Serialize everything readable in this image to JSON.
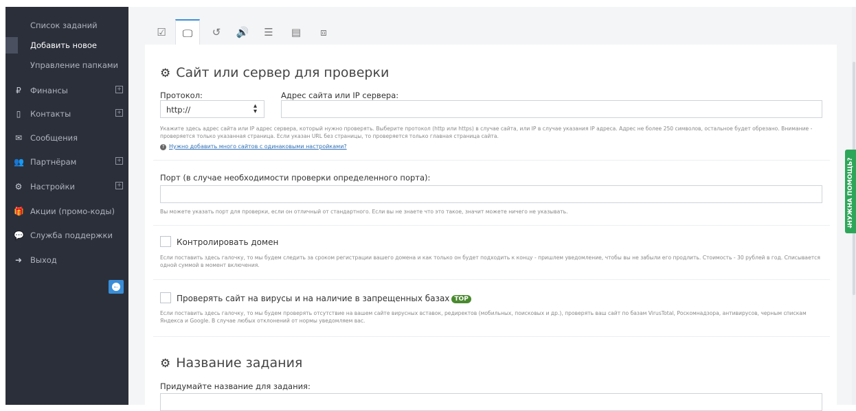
{
  "sidebar": {
    "sub_items": [
      {
        "label": "Список заданий"
      },
      {
        "label": "Добавить новое"
      },
      {
        "label": "Управление папками"
      }
    ],
    "nav": [
      {
        "icon": "₽",
        "label": "Финансы",
        "expandable": true
      },
      {
        "icon": "▯",
        "label": "Контакты",
        "expandable": true
      },
      {
        "icon": "✉",
        "label": "Сообщения",
        "expandable": false
      },
      {
        "icon": "👥",
        "label": "Партнёрам",
        "expandable": true
      },
      {
        "icon": "⚙",
        "label": "Настройки",
        "expandable": true
      },
      {
        "icon": "🎁",
        "label": "Акции (промо-коды)",
        "expandable": false
      },
      {
        "icon": "💬",
        "label": "Служба поддержки",
        "expandable": false
      },
      {
        "icon": "➜",
        "label": "Выход",
        "expandable": false
      }
    ],
    "expand_symbol": "+",
    "collapse_symbol": "←"
  },
  "tabs": [
    {
      "icon": "☑"
    },
    {
      "icon": "🖵"
    },
    {
      "icon": "↺"
    },
    {
      "icon": "🔊"
    },
    {
      "icon": "☰"
    },
    {
      "icon": "▤"
    },
    {
      "icon": "⧈"
    }
  ],
  "section1": {
    "title": "Сайт или сервер для проверки",
    "protocol_label": "Протокол:",
    "protocol_value": "http://",
    "address_label": "Адрес сайта или IP сервера:",
    "address_value": "",
    "address_help": "Укажите здесь адрес сайта или IP адрес сервера, который нужно проверять. Выберите протокол (http или https) в случае сайта, или IP в случае указания IP адреса. Адрес не более 250 символов, остальное будет обрезано. Внимание - проверяется только указанная страница. Если указан URL без страницы, то проверяется только главная страница сайта.",
    "multi_link": "Нужно добавить много сайтов с одинаковыми настройками?",
    "port_label": "Порт (в случае необходимости проверки определенного порта):",
    "port_value": "",
    "port_help": "Вы можете указать порт для проверки, если он отличный от стандартного. Если вы не знаете что это такое, значит можете ничего не указывать.",
    "domain_label": "Контролировать домен",
    "domain_help": "Если поставить здесь галочку, то мы будем следить за сроком регистрации вашего домена и как только он будет подходить к концу - пришлем уведомление, чтобы вы не забыли его продлить. Стоимость - 30 рублей в год. Списывается одной суммой в момент включения.",
    "virus_label": "Проверять сайт на вирусы и на наличие в запрещенных базах",
    "virus_badge": "TOP",
    "virus_help": "Если поставить здесь галочку, то мы будем проверять отсутствие на вашем сайте вирусных вставок, редиректов (мобильных, поисковых и др.), проверять ваш сайт по базам VirusTotal, Роскомнадзора, антивирусов, черным спискам Яндекса и Google. В случае любых отклонений от нормы уведомляем вас."
  },
  "section2": {
    "title": "Название задания",
    "name_label": "Придумайте название для задания:",
    "name_value": ""
  },
  "help_tab": {
    "label": "НУЖНА ПОМОЩЬ?"
  },
  "colors": {
    "sidebar": "#2b2f3a",
    "accent": "#3a8ed8",
    "help": "#2ea65a",
    "badge": "#4a8a2f"
  }
}
